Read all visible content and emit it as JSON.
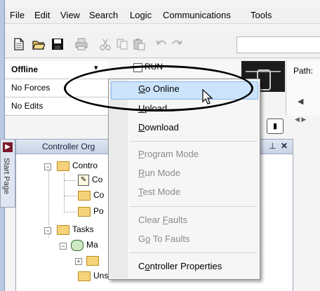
{
  "menubar": {
    "items": [
      "File",
      "Edit",
      "View",
      "Search",
      "Logic",
      "Communications",
      "Tools"
    ]
  },
  "status": {
    "mode": "Offline",
    "forces": "No Forces",
    "edits": "No Edits",
    "run_label": "RUN",
    "path_label": "Path:"
  },
  "organizer": {
    "title": "Controller Org",
    "start_tab": "Start Page",
    "tree": {
      "controller": "Contro",
      "child1": "Co",
      "child2": "Co",
      "child3": "Po",
      "tasks": "Tasks",
      "main_task": "Ma",
      "unscheduled": "Unscheduled"
    }
  },
  "context_menu": {
    "items": [
      {
        "label": "Go Online",
        "accel": "G",
        "rest": "o Online",
        "enabled": true,
        "highlighted": true
      },
      {
        "label": "Upload...",
        "accel": "U",
        "rest": "pload...",
        "enabled": true
      },
      {
        "label": "Download",
        "accel": "D",
        "rest": "ownload",
        "enabled": true
      },
      {
        "label": "Program Mode",
        "accel": "P",
        "rest": "rogram Mode",
        "enabled": false
      },
      {
        "label": "Run Mode",
        "accel": "R",
        "rest": "un Mode",
        "enabled": false
      },
      {
        "label": "Test Mode",
        "accel": "T",
        "rest": "est Mode",
        "enabled": false
      },
      {
        "label": "Clear Faults",
        "pre": "Clear ",
        "accel": "F",
        "rest": "aults",
        "enabled": false
      },
      {
        "label": "Go To Faults",
        "pre": "G",
        "accel": "o",
        "rest": " To Faults",
        "enabled": false
      },
      {
        "label": "Controller Properties",
        "pre": "C",
        "accel": "o",
        "rest": "ntroller Properties",
        "enabled": true
      }
    ]
  }
}
